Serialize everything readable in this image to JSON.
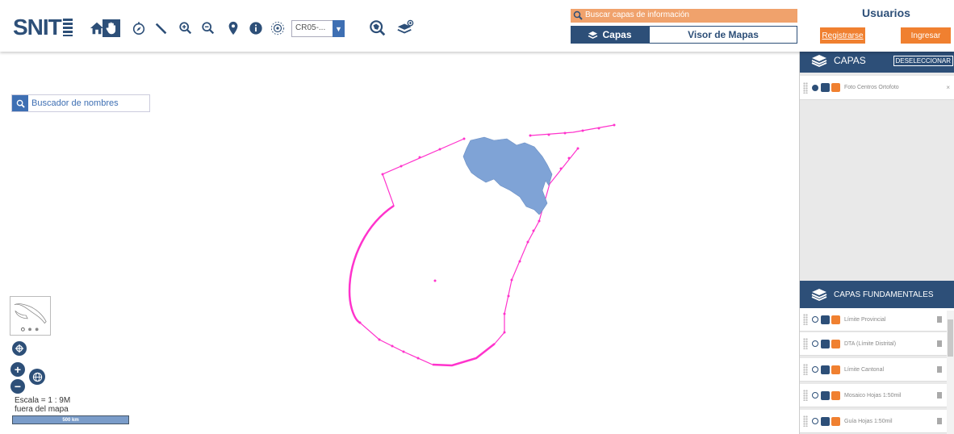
{
  "header": {
    "logo_text": "SNIT",
    "projection_value": "CR05-...",
    "tools": [
      "home-icon",
      "pan-hand-icon",
      "compass-icon",
      "measure-ruler-icon",
      "zoom-in-icon",
      "zoom-out-icon",
      "location-pin-icon",
      "info-icon",
      "target-icon"
    ],
    "search_layers_placeholder": "Buscar capas de información",
    "tab_capas": "Capas",
    "tab_visor": "Visor de Mapas",
    "usuarios": "Usuarios",
    "btn_registrarse": "Registrarse",
    "btn_ingresar": "Ingresar"
  },
  "map": {
    "name_search_placeholder": "Buscador de nombres",
    "scale_label": "Escala = 1 : 9M",
    "scale_note": "fuera del mapa",
    "scale_bar": "500 km"
  },
  "panel": {
    "capas_title": "CAPAS",
    "deselect_label": "DESELECCIONAR",
    "active_layers": [
      {
        "name": "Foto Centros Ortofoto",
        "checked": true
      }
    ],
    "fundamentales_title": "CAPAS FUNDAMENTALES",
    "fundamental_layers": [
      {
        "name": "Límite Provincial",
        "checked": false
      },
      {
        "name": "DTA (Límite Distrital)",
        "checked": false
      },
      {
        "name": "Límite Cantonal",
        "checked": false
      },
      {
        "name": "Mosaico Hojas 1:50mil",
        "checked": false
      },
      {
        "name": "Guía Hojas 1:50mil",
        "checked": false
      }
    ]
  },
  "colors": {
    "primary": "#2d4f78",
    "accent": "#f08030",
    "boundary": "#ff33cc",
    "land": "#7fa3d6"
  }
}
